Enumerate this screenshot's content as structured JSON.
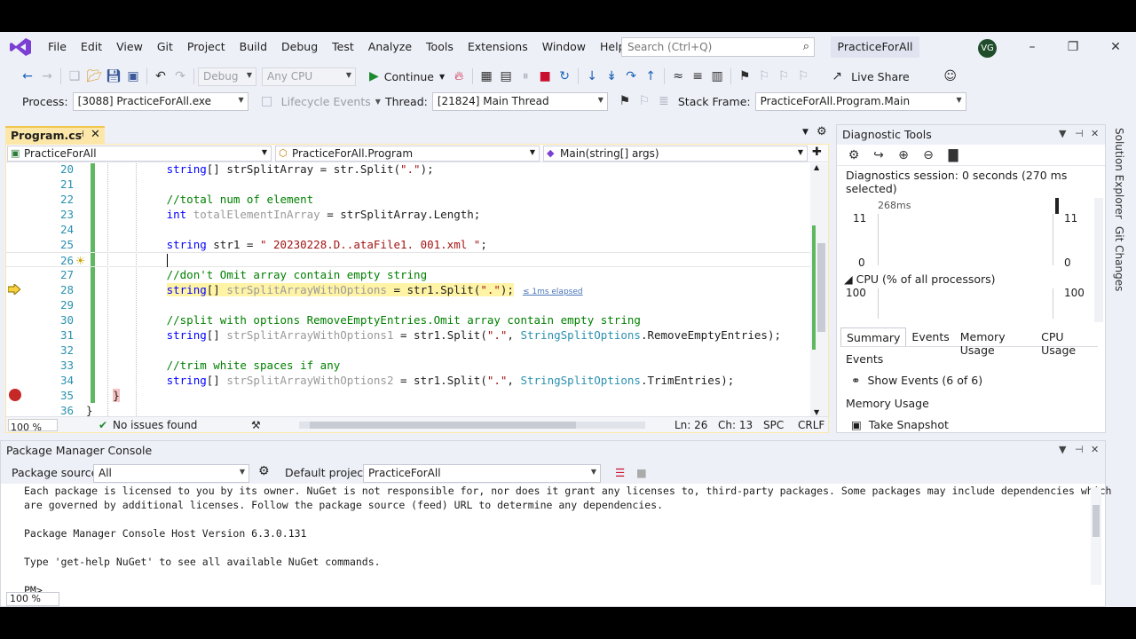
{
  "menu": {
    "items": [
      "File",
      "Edit",
      "View",
      "Git",
      "Project",
      "Build",
      "Debug",
      "Test",
      "Analyze",
      "Tools",
      "Extensions",
      "Window",
      "Help"
    ],
    "search_placeholder": "Search (Ctrl+Q)",
    "solution_name": "PracticeForAll",
    "user_initials": "VG"
  },
  "toolbar": {
    "config": "Debug",
    "platform": "Any CPU",
    "continue_label": "Continue",
    "live_share": "Live Share"
  },
  "debug_bar": {
    "process_label": "Process:",
    "process_value": "[3088] PracticeForAll.exe",
    "lifecycle_label": "Lifecycle Events",
    "thread_label": "Thread:",
    "thread_value": "[21824] Main Thread",
    "stack_label": "Stack Frame:",
    "stack_value": "PracticeForAll.Program.Main"
  },
  "editor": {
    "tab_name": "Program.cs",
    "nav_project": "PracticeForAll",
    "nav_class": "PracticeForAll.Program",
    "nav_member": "Main(string[] args)",
    "lines": [
      {
        "n": "20",
        "parts": [
          [
            "kw",
            "string"
          ],
          [
            "",
            "[] "
          ],
          [
            "",
            "strSplitArray = str.Split("
          ],
          [
            "str",
            "\".\""
          ],
          [
            "",
            ");"
          ]
        ]
      },
      {
        "n": "21",
        "parts": []
      },
      {
        "n": "22",
        "parts": [
          [
            "cm",
            "//total num of element"
          ]
        ]
      },
      {
        "n": "23",
        "parts": [
          [
            "kw",
            "int"
          ],
          [
            "",
            " "
          ],
          [
            "dim",
            "totalElementInArray"
          ],
          [
            "",
            " = strSplitArray.Length;"
          ]
        ]
      },
      {
        "n": "24",
        "parts": []
      },
      {
        "n": "25",
        "parts": [
          [
            "kw",
            "string"
          ],
          [
            "",
            " str1 = "
          ],
          [
            "str",
            "\" 20230228.D..ataFile1. 001.xml \""
          ],
          [
            "",
            ";"
          ]
        ]
      },
      {
        "n": "26",
        "parts": []
      },
      {
        "n": "27",
        "parts": [
          [
            "cm",
            "//don't Omit array contain empty string"
          ]
        ]
      },
      {
        "n": "28",
        "parts": [
          [
            "kw",
            "string"
          ],
          [
            "",
            "[] "
          ],
          [
            "dim",
            "strSplitArrayWithOptions"
          ],
          [
            "",
            " = str1.Split("
          ],
          [
            "str",
            "\".\""
          ],
          [
            "",
            ");"
          ]
        ]
      },
      {
        "n": "29",
        "parts": []
      },
      {
        "n": "30",
        "parts": [
          [
            "cm",
            "//split with options RemoveEmptyEntries.Omit array contain empty string"
          ]
        ]
      },
      {
        "n": "31",
        "parts": [
          [
            "kw",
            "string"
          ],
          [
            "",
            "[] "
          ],
          [
            "dim",
            "strSplitArrayWithOptions1"
          ],
          [
            "",
            " = str1.Split("
          ],
          [
            "str",
            "\".\""
          ],
          [
            ",",
            ", "
          ],
          [
            "ty",
            "StringSplitOptions"
          ],
          [
            "",
            ".RemoveEmptyEntries);"
          ]
        ]
      },
      {
        "n": "32",
        "parts": []
      },
      {
        "n": "33",
        "parts": [
          [
            "cm",
            "//trim white spaces if any"
          ]
        ]
      },
      {
        "n": "34",
        "parts": [
          [
            "kw",
            "string"
          ],
          [
            "",
            "[] "
          ],
          [
            "dim",
            "strSplitArrayWithOptions2"
          ],
          [
            "",
            " = str1.Split("
          ],
          [
            "str",
            "\".\""
          ],
          [
            ",",
            ", "
          ],
          [
            "ty",
            "StringSplitOptions"
          ],
          [
            "",
            ".TrimEntries);"
          ]
        ]
      },
      {
        "n": "35",
        "parts": [
          [
            "",
            "}"
          ]
        ]
      },
      {
        "n": "36",
        "parts": [
          [
            "",
            "}"
          ]
        ]
      }
    ],
    "elapsed": "≤ 1ms elapsed",
    "zoom": "100 %",
    "issues": "No issues found",
    "position_ln": "Ln: 26",
    "position_ch": "Ch: 13",
    "spc": "SPC",
    "crlf": "CRLF"
  },
  "diagnostics": {
    "title": "Diagnostic Tools",
    "session": "Diagnostics session: 0 seconds (270 ms selected)",
    "time_marker": "268ms",
    "mem_max": "11",
    "mem_min": "0",
    "cpu_header": "CPU (% of all processors)",
    "cpu_max": "100",
    "tabs": [
      "Summary",
      "Events",
      "Memory Usage",
      "CPU Usage"
    ],
    "events_header": "Events",
    "show_events": "Show Events (6 of 6)",
    "memory_header": "Memory Usage",
    "take_snapshot": "Take Snapshot"
  },
  "side_tabs": [
    "Solution Explorer",
    "Git Changes"
  ],
  "pmc": {
    "title": "Package Manager Console",
    "source_label": "Package source:",
    "source_value": "All",
    "project_label": "Default project:",
    "project_value": "PracticeForAll",
    "lines": [
      "Each package is licensed to you by its owner. NuGet is not responsible for, nor does it grant any licenses to, third-party packages. Some packages may include dependencies which",
      "are governed by additional licenses. Follow the package source (feed) URL to determine any dependencies.",
      "",
      "Package Manager Console Host Version 6.3.0.131",
      "",
      "Type 'get-help NuGet' to see all available NuGet commands.",
      "",
      "PM>"
    ],
    "zoom": "100 %"
  }
}
